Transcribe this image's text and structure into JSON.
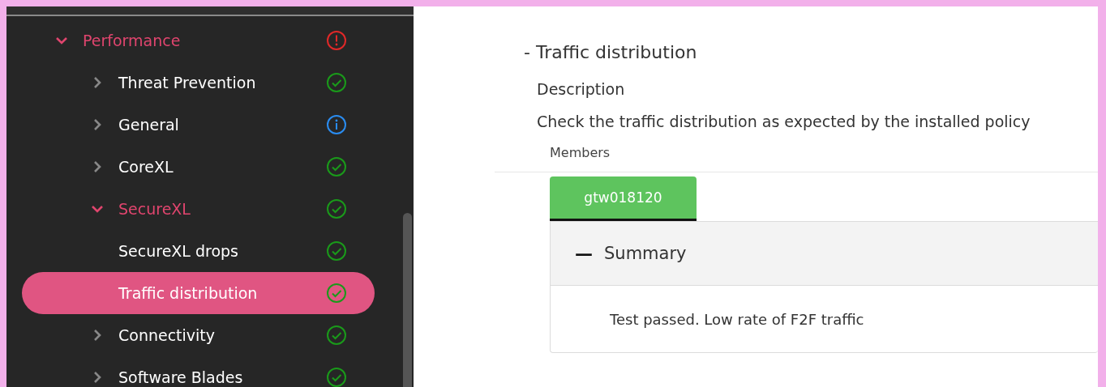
{
  "tree": [
    {
      "label": "Performance",
      "has_children": true,
      "expanded": true,
      "selected": false,
      "kind": "error",
      "children": [
        {
          "label": "Threat Prevention",
          "has_children": true,
          "expanded": false,
          "selected": false,
          "kind": "ok"
        },
        {
          "label": "General",
          "has_children": true,
          "expanded": false,
          "selected": false,
          "kind": "info"
        },
        {
          "label": "CoreXL",
          "has_children": true,
          "expanded": false,
          "selected": false,
          "kind": "ok"
        },
        {
          "label": "SecureXL",
          "has_children": true,
          "expanded": true,
          "selected": false,
          "kind": "ok",
          "children": [
            {
              "label": "SecureXL drops",
              "has_children": false,
              "expanded": false,
              "selected": false,
              "kind": "ok"
            },
            {
              "label": "Traffic distribution",
              "has_children": false,
              "expanded": false,
              "selected": true,
              "kind": "ok"
            }
          ]
        },
        {
          "label": "Connectivity",
          "has_children": true,
          "expanded": false,
          "selected": false,
          "kind": "ok"
        },
        {
          "label": "Software Blades",
          "has_children": true,
          "expanded": false,
          "selected": false,
          "kind": "ok"
        }
      ]
    }
  ],
  "detail": {
    "title": "- Traffic distribution",
    "description_label": "Description",
    "description": "Check the traffic distribution as expected by the installed policy",
    "members_label": "Members",
    "member_tabs": [
      {
        "label": "gtw018120",
        "selected": true
      }
    ],
    "summary": {
      "toggle": "—",
      "title": "Summary",
      "text": "Test passed. Low rate of F2F traffic"
    }
  }
}
